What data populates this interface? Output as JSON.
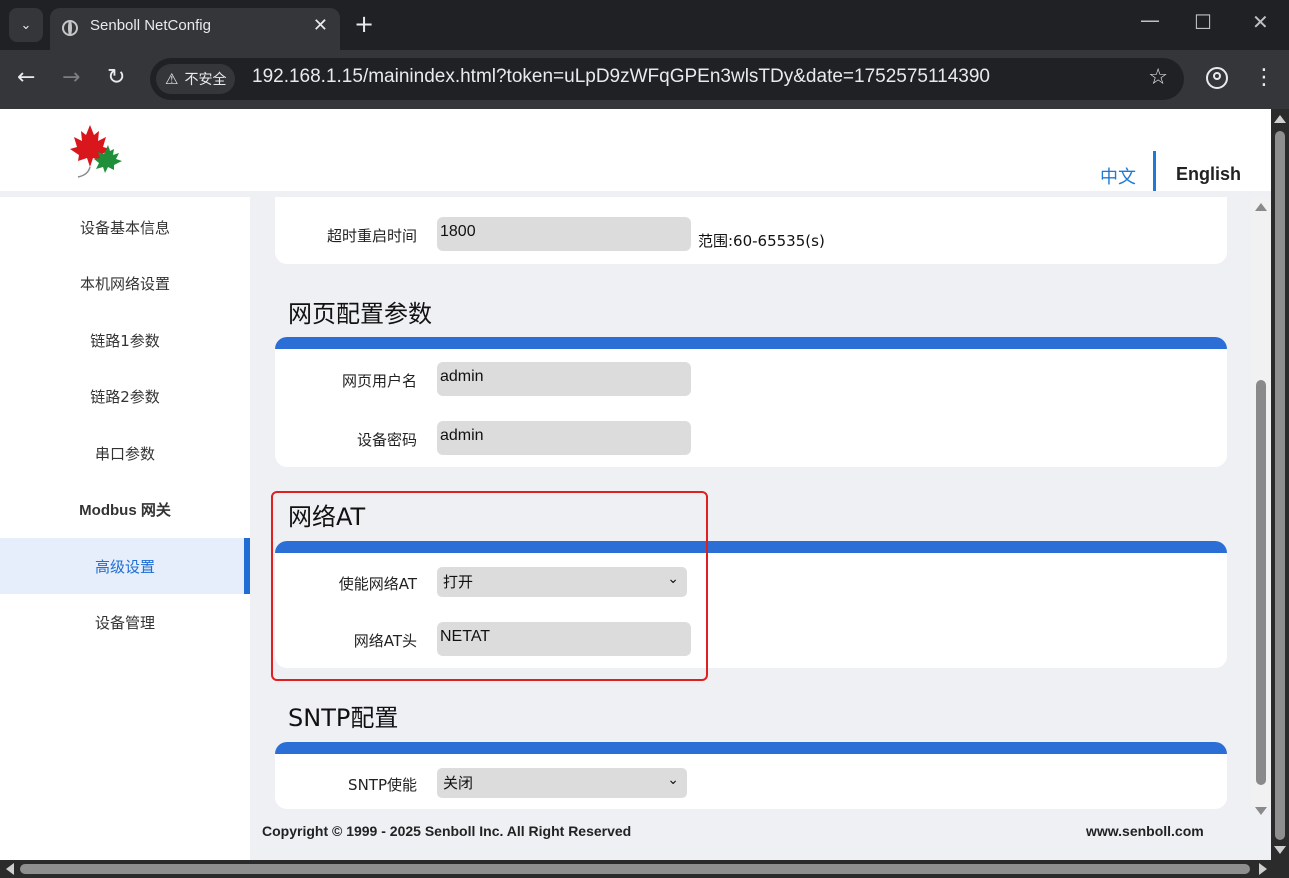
{
  "browser": {
    "tab_title": "Senboll NetConfig",
    "tab_close": "✕",
    "new_tab": "+",
    "window_minimize": "—",
    "window_maximize": "☐",
    "window_close": "✕",
    "security_label": "不安全",
    "url": "192.168.1.15/mainindex.html?token=uLpD9zWFqGPEn3wlsTDy&date=1752575114390",
    "icons": [
      "tab-list-icon",
      "globe-icon",
      "back-icon",
      "forward-icon",
      "reload-icon",
      "warning-icon",
      "star-icon",
      "profile-icon",
      "more-icon"
    ]
  },
  "header": {
    "lang_zh": "中文",
    "lang_en": "English"
  },
  "sidebar": {
    "items": [
      {
        "label": "设备基本信息"
      },
      {
        "label": "本机网络设置"
      },
      {
        "label": "链路1参数"
      },
      {
        "label": "链路2参数"
      },
      {
        "label": "串口参数"
      },
      {
        "label": "Modbus 网关"
      },
      {
        "label": "高级设置"
      },
      {
        "label": "设备管理"
      }
    ],
    "active_index": 6
  },
  "main": {
    "timeout": {
      "label": "超时重启时间",
      "value": "1800",
      "hint": "范围:60-65535(s)"
    },
    "web": {
      "title": "网页配置参数",
      "username_label": "网页用户名",
      "username_value": "admin",
      "password_label": "设备密码",
      "password_value": "admin"
    },
    "netat": {
      "title": "网络AT",
      "enable_label": "使能网络AT",
      "enable_value": "打开",
      "header_label": "网络AT头",
      "header_value": "NETAT"
    },
    "sntp": {
      "title": "SNTP配置",
      "enable_label": "SNTP使能",
      "enable_value": "关闭"
    }
  },
  "footer": {
    "copyright": "Copyright © 1999 - 2025 Senboll Inc. All Right Reserved",
    "site": "www.senboll.com"
  },
  "colors": {
    "accent": "#2b6fd6",
    "active_bg": "#e6eefc",
    "highlight_border": "#e02020",
    "page_bg": "#eef0f4"
  }
}
